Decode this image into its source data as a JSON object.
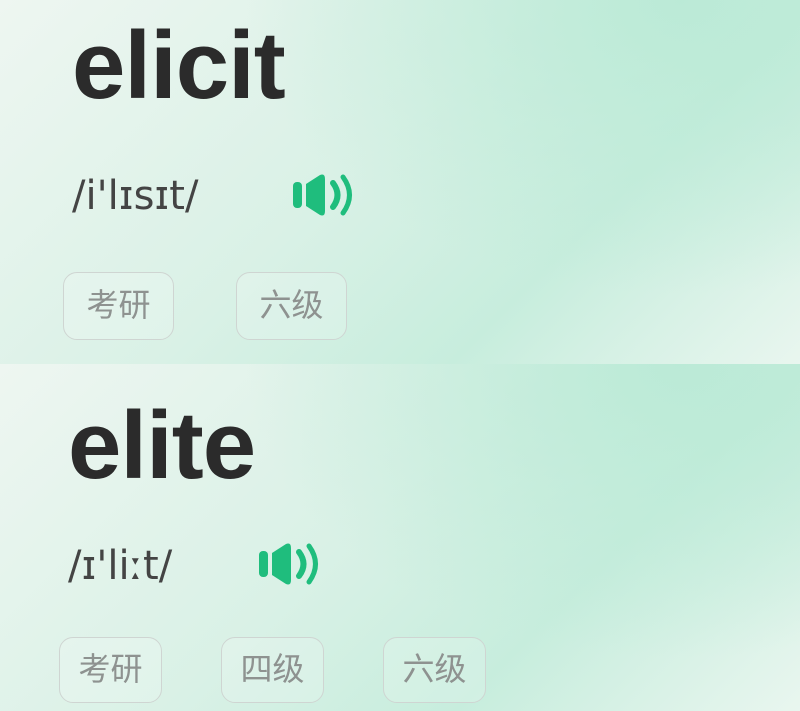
{
  "entries": [
    {
      "word": "elicit",
      "phonetic": "/i'lɪsɪt/",
      "audio_icon": "speaker-icon",
      "tags": [
        "考研",
        "六级"
      ]
    },
    {
      "word": "elite",
      "phonetic": "/ɪ'liːt/",
      "audio_icon": "speaker-icon",
      "tags": [
        "考研",
        "四级",
        "六级"
      ]
    }
  ],
  "colors": {
    "accent": "#1fbd7d",
    "word_text": "#2b2b2b",
    "tag_border": "#cfd5d2",
    "tag_text": "#8e9290"
  }
}
